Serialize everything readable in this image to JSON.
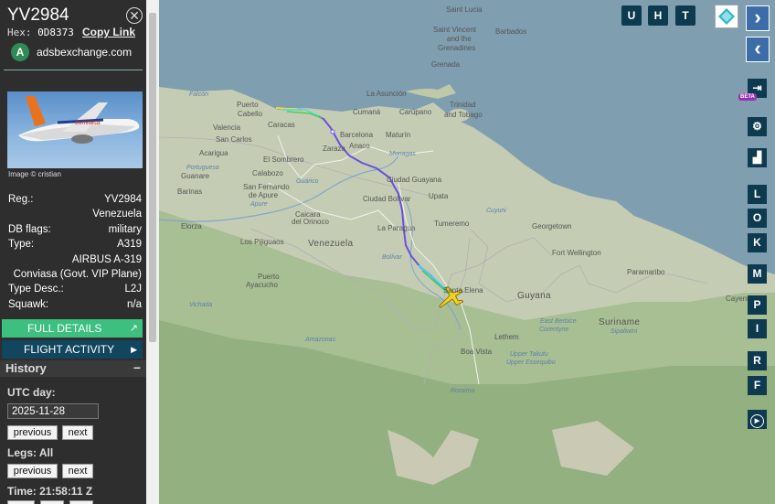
{
  "aircraft": {
    "callsign": "YV2984",
    "hex_label": "Hex:",
    "hex": "0D8373",
    "copy_link": "Copy Link",
    "site": "adsbexchange.com",
    "site_logo": "A",
    "image_credit": "Image © cristian",
    "fields": [
      {
        "label": "Reg.:",
        "value": "YV2984"
      },
      {
        "label": "",
        "value": "Venezuela"
      },
      {
        "label": "DB flags:",
        "value": "military"
      },
      {
        "label": "Type:",
        "value": "A319"
      },
      {
        "label": "",
        "value": "AIRBUS A-319"
      },
      {
        "label": "",
        "value": "Conviasa (Govt. VIP Plane)"
      },
      {
        "label": "Type Desc.:",
        "value": "L2J"
      },
      {
        "label": "Squawk:",
        "value": "n/a"
      }
    ]
  },
  "buttons": {
    "full_details": "FULL DETAILS",
    "flight_activity": "FLIGHT ACTIVITY",
    "external_icon": "↗",
    "arrow_icon": "▶"
  },
  "history": {
    "title": "History",
    "collapse": "−",
    "utc_day_label": "UTC day:",
    "date": "2025-11-28",
    "previous": "previous",
    "next": "next",
    "legs_label": "Legs: All",
    "time_label": "Time: 21:58:11 Z"
  },
  "map": {
    "top_buttons": [
      "U",
      "H",
      "T"
    ],
    "right_buttons": [
      "L",
      "O",
      "K",
      "M",
      "P",
      "I",
      "R",
      "F"
    ],
    "beta": "BETA",
    "nav_right": "›",
    "nav_left": "‹",
    "labels": [
      {
        "t": "Saint Lucia",
        "k": "plain"
      },
      {
        "t": "Saint Vincent",
        "k": "plain"
      },
      {
        "t": "and the",
        "k": "plain"
      },
      {
        "t": "Grenadines",
        "k": "plain"
      },
      {
        "t": "Barbados",
        "k": "plain"
      },
      {
        "t": "Grenada",
        "k": "plain"
      },
      {
        "t": "Trinidad",
        "k": "plain"
      },
      {
        "t": "and Tobago",
        "k": "plain"
      },
      {
        "t": "La Asunción",
        "k": "plain"
      },
      {
        "t": "Cumaná",
        "k": "plain"
      },
      {
        "t": "Carúpano",
        "k": "plain"
      },
      {
        "t": "Puerto",
        "k": "plain"
      },
      {
        "t": "Cabello",
        "k": "plain"
      },
      {
        "t": "Valencia",
        "k": "plain"
      },
      {
        "t": "Caracas",
        "k": "plain"
      },
      {
        "t": "San Carlos",
        "k": "plain"
      },
      {
        "t": "Barcelona",
        "k": "plain"
      },
      {
        "t": "Maturín",
        "k": "plain"
      },
      {
        "t": "Anaco",
        "k": "plain"
      },
      {
        "t": "Zaraza",
        "k": "plain"
      },
      {
        "t": "Acarigua",
        "k": "plain"
      },
      {
        "t": "El Sombrero",
        "k": "plain"
      },
      {
        "t": "Guanare",
        "k": "plain"
      },
      {
        "t": "Calabozo",
        "k": "plain"
      },
      {
        "t": "Ciudad Guayana",
        "k": "plain"
      },
      {
        "t": "Ciudad Bolívar",
        "k": "plain"
      },
      {
        "t": "Upata",
        "k": "plain"
      },
      {
        "t": "Barinas",
        "k": "plain"
      },
      {
        "t": "San Fernando",
        "k": "plain"
      },
      {
        "t": "de Apure",
        "k": "plain"
      },
      {
        "t": "Caicara",
        "k": "plain"
      },
      {
        "t": "del Orinoco",
        "k": "plain"
      },
      {
        "t": "La Paragua",
        "k": "plain"
      },
      {
        "t": "Tumeremo",
        "k": "plain"
      },
      {
        "t": "Georgetown",
        "k": "plain"
      },
      {
        "t": "Elorza",
        "k": "plain"
      },
      {
        "t": "Los Pijiguaos",
        "k": "plain"
      },
      {
        "t": "Venezuela",
        "k": "country"
      },
      {
        "t": "Fort Wellington",
        "k": "plain"
      },
      {
        "t": "Paramaribo",
        "k": "plain"
      },
      {
        "t": "Puerto",
        "k": "plain"
      },
      {
        "t": "Ayacucho",
        "k": "plain"
      },
      {
        "t": "Santa Elena",
        "k": "plain"
      },
      {
        "t": "Guyana",
        "k": "country"
      },
      {
        "t": "Suriname",
        "k": "country"
      },
      {
        "t": "Lethem",
        "k": "plain"
      },
      {
        "t": "Boa Vista",
        "k": "plain"
      },
      {
        "t": "Amazonas",
        "k": "river"
      },
      {
        "t": "Bolívar",
        "k": "river"
      },
      {
        "t": "Vichada",
        "k": "river"
      },
      {
        "t": "East Berbice",
        "k": "river"
      },
      {
        "t": "Corentyne",
        "k": "river"
      },
      {
        "t": "Sipaliwini",
        "k": "river"
      },
      {
        "t": "Upper Takutu",
        "k": "river"
      },
      {
        "t": "Upper Essequibo",
        "k": "river"
      },
      {
        "t": "Roraima",
        "k": "river"
      },
      {
        "t": "Cayenne",
        "k": "plain"
      },
      {
        "t": "Cuyuni",
        "k": "river"
      },
      {
        "t": "Monagas",
        "k": "river"
      },
      {
        "t": "Falcón",
        "k": "river"
      },
      {
        "t": "Portuguesa",
        "k": "river"
      },
      {
        "t": "Apure",
        "k": "river"
      },
      {
        "t": "Guárico",
        "k": "river"
      }
    ]
  },
  "colors": {
    "sidebar_bg": "#2e2e2e",
    "full_details_bg": "#3cbf7f",
    "flight_activity_bg": "#12455e",
    "map_btn_bg": "#0d3a4f",
    "track": "#6a4fe0",
    "aircraft_icon": "#f2d21f"
  }
}
